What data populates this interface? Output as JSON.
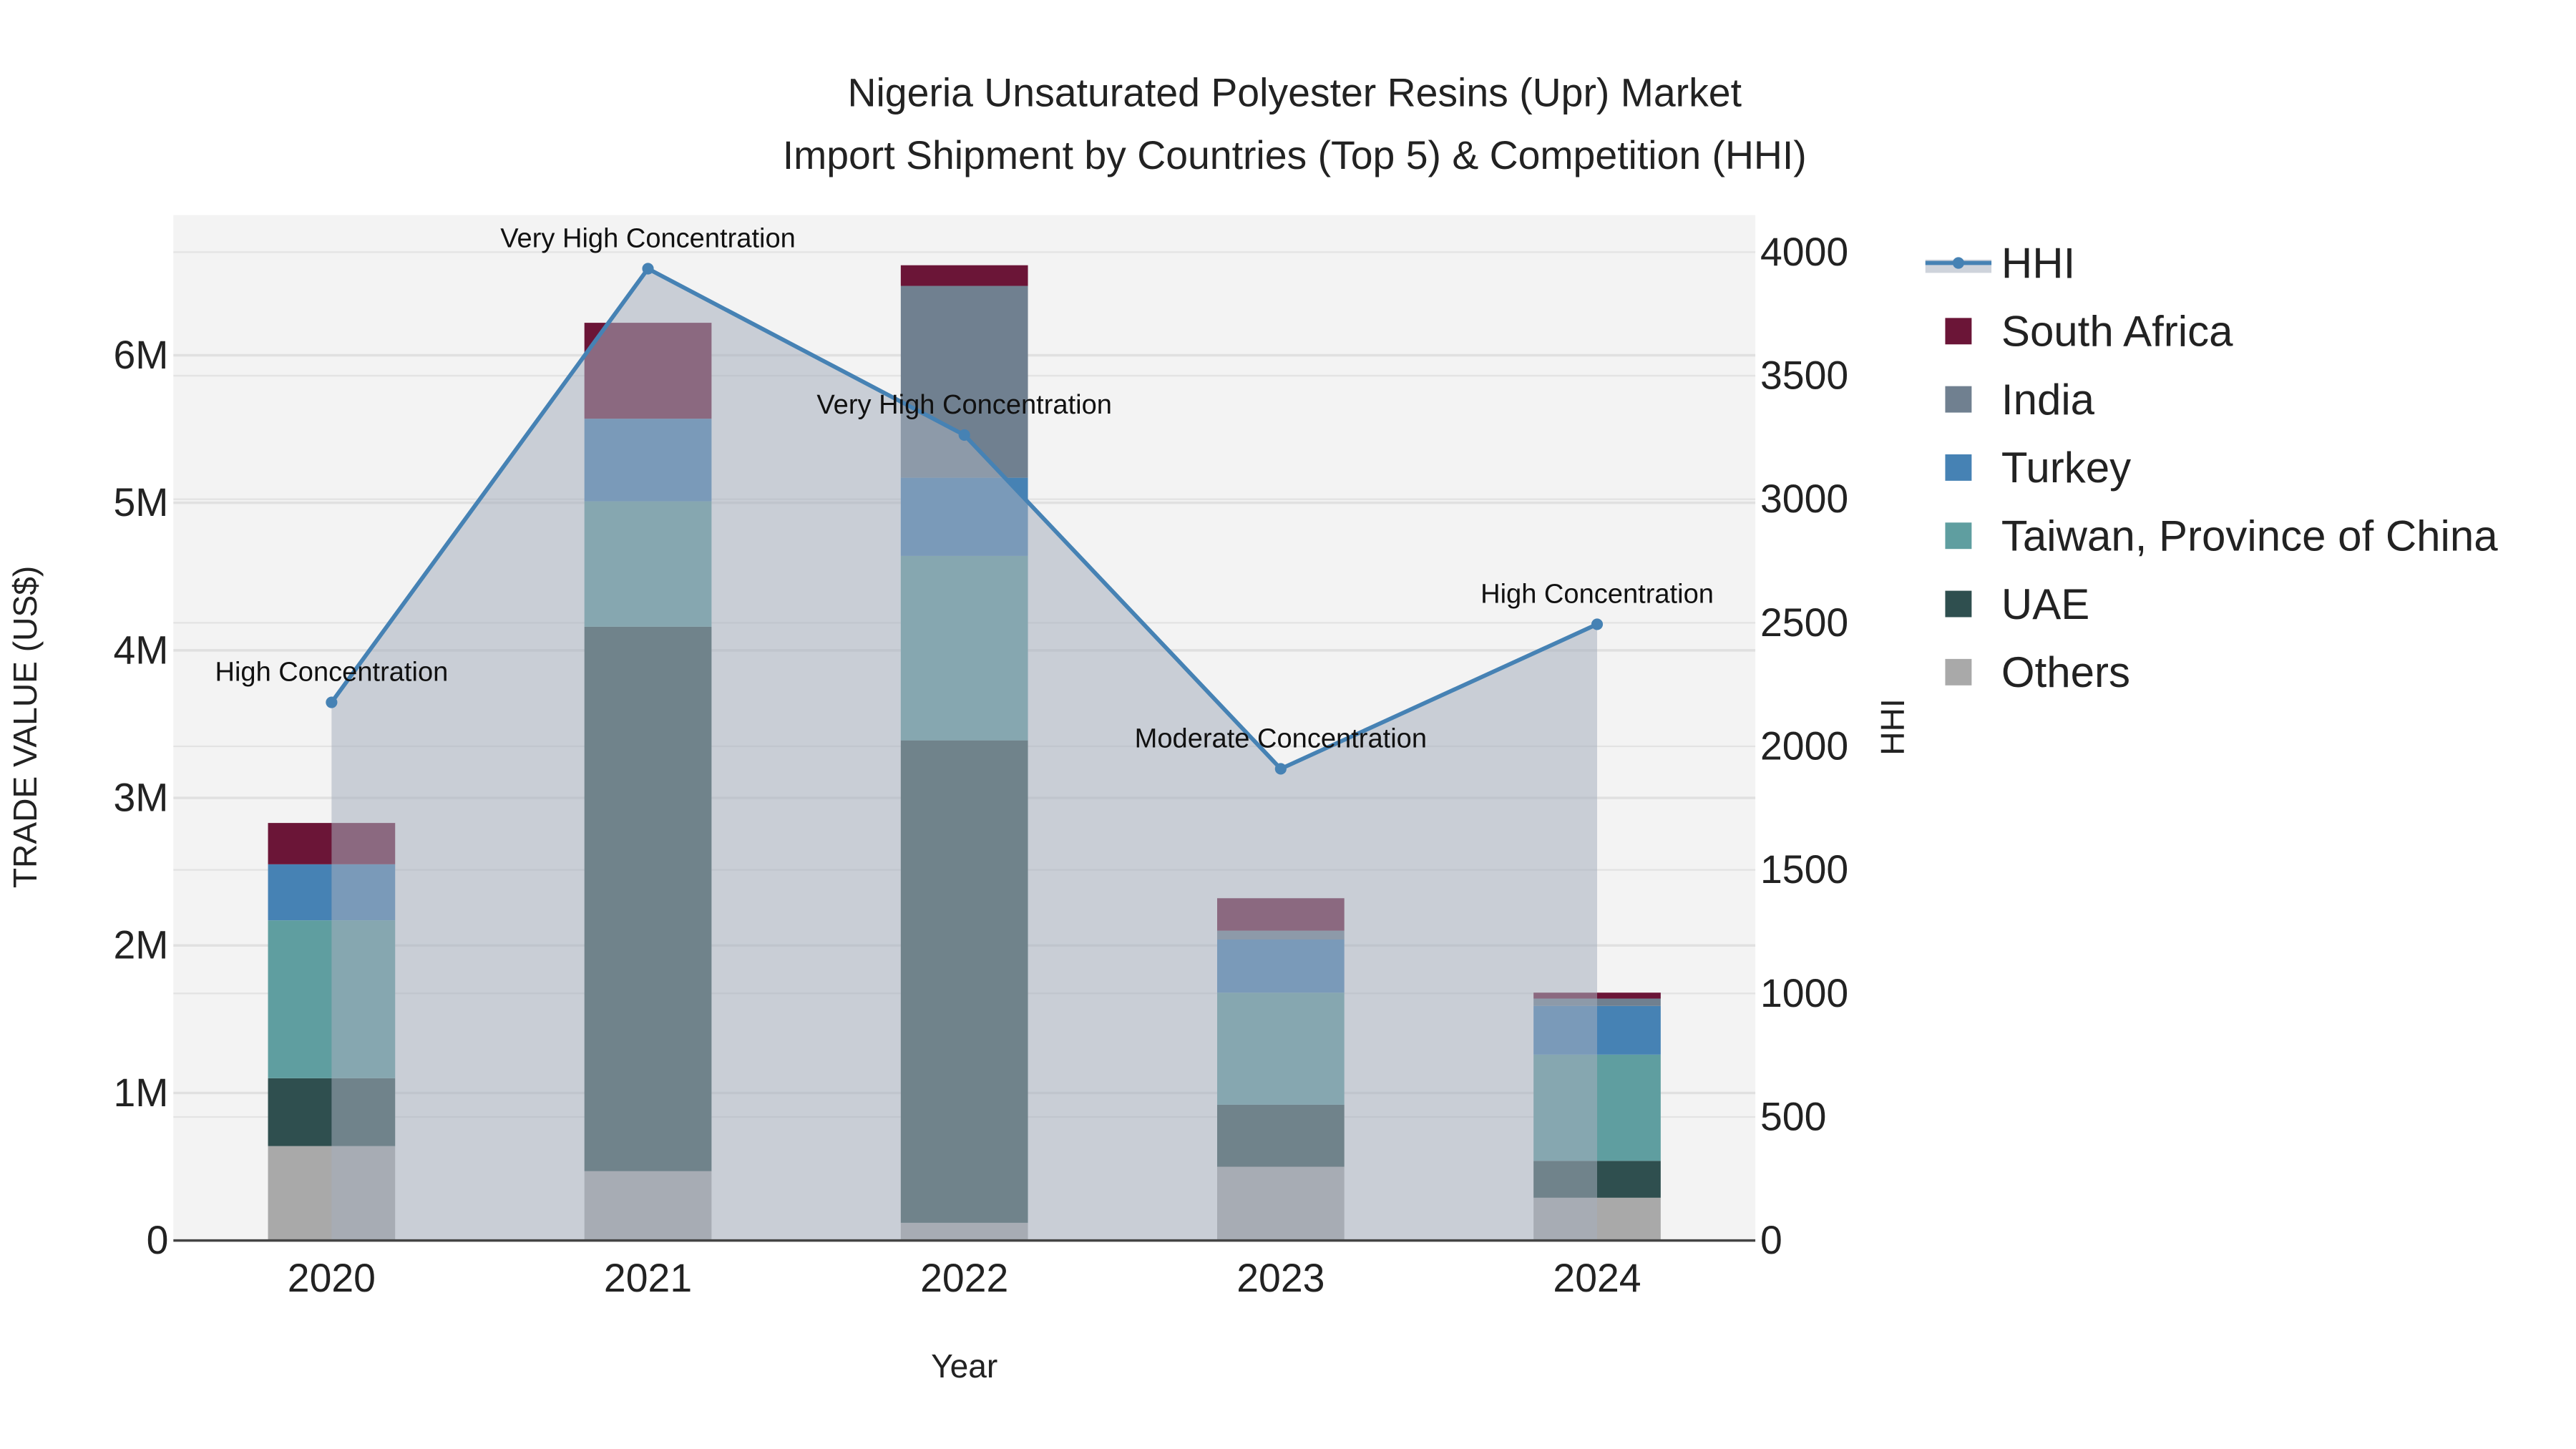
{
  "chart_data": {
    "type": "bar",
    "title_line1": "Nigeria Unsaturated Polyester Resins (Upr) Market",
    "title_line2": "Import Shipment by Countries (Top 5) & Competition (HHI)",
    "xlabel": "Year",
    "ylabel": "TRADE VALUE (US$)",
    "y2label": "HHI",
    "categories": [
      "2020",
      "2021",
      "2022",
      "2023",
      "2024"
    ],
    "ylim": [
      0,
      6950000
    ],
    "y2lim": [
      0,
      4150
    ],
    "yticks": [
      {
        "v": 0,
        "label": "0"
      },
      {
        "v": 1000000,
        "label": "1M"
      },
      {
        "v": 2000000,
        "label": "2M"
      },
      {
        "v": 3000000,
        "label": "3M"
      },
      {
        "v": 4000000,
        "label": "4M"
      },
      {
        "v": 5000000,
        "label": "5M"
      },
      {
        "v": 6000000,
        "label": "6M"
      }
    ],
    "y2ticks": [
      {
        "v": 0,
        "label": "0"
      },
      {
        "v": 500,
        "label": "500"
      },
      {
        "v": 1000,
        "label": "1000"
      },
      {
        "v": 1500,
        "label": "1500"
      },
      {
        "v": 2000,
        "label": "2000"
      },
      {
        "v": 2500,
        "label": "2500"
      },
      {
        "v": 3000,
        "label": "3000"
      },
      {
        "v": 3500,
        "label": "3500"
      },
      {
        "v": 4000,
        "label": "4000"
      }
    ],
    "series": [
      {
        "name": "Others",
        "color": "#a9a9a9",
        "values": [
          640000,
          470000,
          120000,
          500000,
          290000
        ]
      },
      {
        "name": "UAE",
        "color": "#2f4f4f",
        "values": [
          460000,
          3690000,
          3270000,
          420000,
          250000
        ]
      },
      {
        "name": "Taiwan, Province of China",
        "color": "#5f9ea0",
        "values": [
          1070000,
          850000,
          1250000,
          760000,
          720000
        ]
      },
      {
        "name": "Turkey",
        "color": "#4682b4",
        "values": [
          380000,
          560000,
          530000,
          360000,
          330000
        ]
      },
      {
        "name": "India",
        "color": "#708090",
        "values": [
          0,
          0,
          1300000,
          60000,
          50000
        ]
      },
      {
        "name": "South Africa",
        "color": "#6b1537",
        "values": [
          280000,
          650000,
          140000,
          220000,
          40000
        ]
      }
    ],
    "hhi": {
      "name": "HHI",
      "color": "#4682b4",
      "values": [
        2178,
        3933,
        3260,
        1909,
        2494
      ],
      "annotations": [
        "High Concentration",
        "Very High Concentration",
        "Very High Concentration",
        "Moderate Concentration",
        "High Concentration"
      ]
    },
    "legend_order": [
      "HHI",
      "South Africa",
      "India",
      "Turkey",
      "Taiwan, Province of China",
      "UAE",
      "Others"
    ],
    "legend_placement": "right",
    "grid": true
  }
}
